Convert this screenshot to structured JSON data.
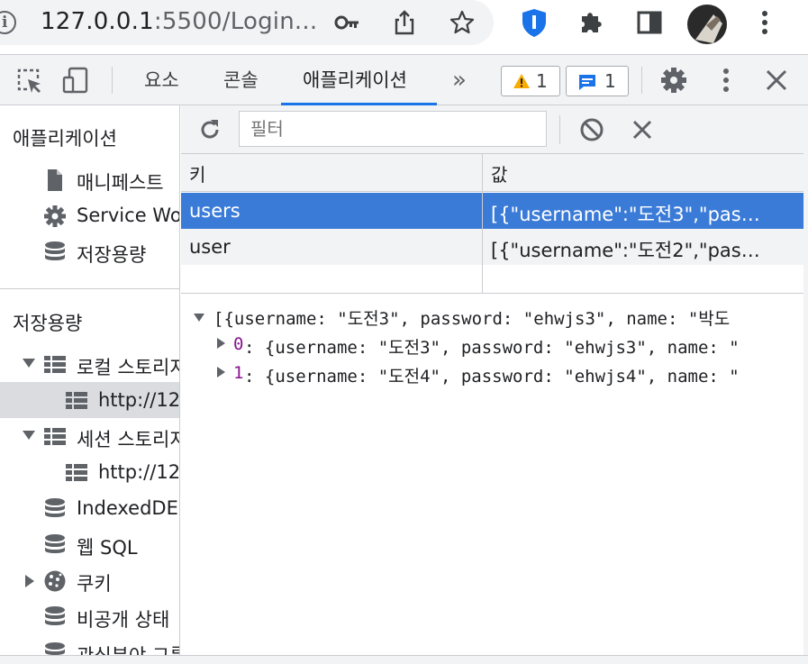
{
  "browser": {
    "url_host": "127.0.0.1",
    "url_rest": ":5500/Login...",
    "icons": [
      "info-icon",
      "key-icon",
      "share-icon",
      "star-icon",
      "extension-shield-icon",
      "puzzle-icon",
      "sidepanel-icon",
      "profile-avatar",
      "kebab-menu-icon"
    ]
  },
  "devtools": {
    "tabs": [
      {
        "label": "요소"
      },
      {
        "label": "콘솔"
      },
      {
        "label": "애플리케이션"
      }
    ],
    "more_tabs": "»",
    "warnings_count": "1",
    "messages_count": "1",
    "accent": "#1a73e8"
  },
  "sidebar": {
    "app_section_title": "애플리케이션",
    "app_items": [
      {
        "label": "매니페스트",
        "icon": "file-icon"
      },
      {
        "label": "Service Wo",
        "icon": "gear-icon"
      },
      {
        "label": "저장용량",
        "icon": "database-icon"
      }
    ],
    "storage_section_title": "저장용량",
    "storage_items": [
      {
        "label": "로컬 스토리지",
        "icon": "grid-icon",
        "expanded": true
      },
      {
        "label": "http://12",
        "icon": "grid-icon",
        "selected": true
      },
      {
        "label": "세션 스토리지",
        "icon": "grid-icon",
        "expanded": true
      },
      {
        "label": "http://12",
        "icon": "grid-icon"
      },
      {
        "label": "IndexedDE",
        "icon": "database-icon"
      },
      {
        "label": "웹 SQL",
        "icon": "database-icon"
      },
      {
        "label": "쿠키",
        "icon": "cookie-icon",
        "expanded": false
      },
      {
        "label": "비공개 상태",
        "icon": "database-icon"
      },
      {
        "label": "관심분야 그룹",
        "icon": "database-icon"
      }
    ]
  },
  "storage": {
    "filter_placeholder": "필터",
    "columns": {
      "key": "키",
      "value": "값"
    },
    "rows": [
      {
        "key": "users",
        "value": "[{\"username\":\"도전3\",\"pas…",
        "selected": true
      },
      {
        "key": "user",
        "value": "[{\"username\":\"도전2\",\"pas…",
        "selected": false
      }
    ],
    "selection_color": "#3b7bd8",
    "preview": {
      "root": "[{username: \"도전3\", password: \"ehwjs3\", name: \"박도",
      "items": [
        {
          "index": "0",
          "text": ": {username: \"도전3\", password: \"ehwjs3\", name: \""
        },
        {
          "index": "1",
          "text": ": {username: \"도전4\", password: \"ehwjs4\", name: \""
        }
      ]
    }
  }
}
